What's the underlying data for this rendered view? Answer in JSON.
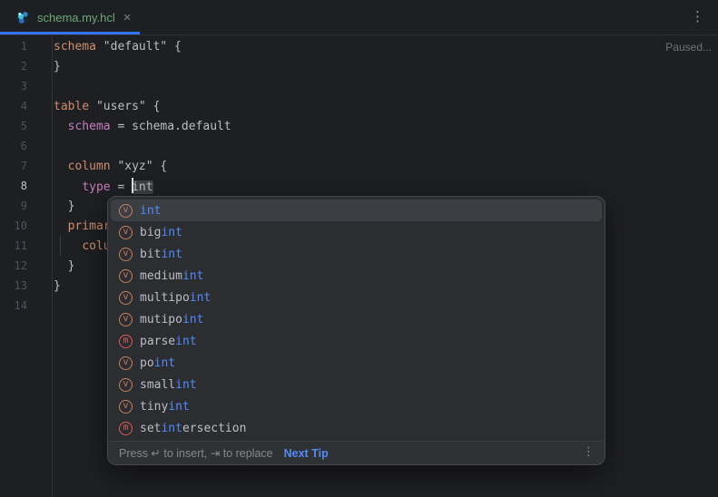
{
  "tab_bar": {
    "tab_title": "schema.my.hcl",
    "close_label": "×",
    "menu_icon": "⋮"
  },
  "editor": {
    "status": "Paused...",
    "lines": [
      {
        "num": "1",
        "segs": [
          [
            "kw",
            "schema"
          ],
          [
            "plain",
            " \"default\" {"
          ]
        ]
      },
      {
        "num": "2",
        "segs": [
          [
            "plain",
            "}"
          ]
        ]
      },
      {
        "num": "3",
        "segs": []
      },
      {
        "num": "4",
        "segs": [
          [
            "kw",
            "table"
          ],
          [
            "plain",
            " \"users\" {"
          ]
        ]
      },
      {
        "num": "5",
        "segs": [
          [
            "plain",
            "  "
          ],
          [
            "prop",
            "schema"
          ],
          [
            "plain",
            " = schema.default"
          ]
        ]
      },
      {
        "num": "6",
        "segs": []
      },
      {
        "num": "7",
        "segs": [
          [
            "plain",
            "  "
          ],
          [
            "kw",
            "column"
          ],
          [
            "plain",
            " \"xyz\" {"
          ]
        ]
      },
      {
        "num": "8",
        "current": true,
        "segs": [
          [
            "plain",
            "    "
          ],
          [
            "prop",
            "type"
          ],
          [
            "plain",
            " = "
          ],
          [
            "caret",
            ""
          ],
          [
            "boxed",
            "int"
          ]
        ]
      },
      {
        "num": "9",
        "segs": [
          [
            "plain",
            "  }"
          ]
        ]
      },
      {
        "num": "10",
        "segs": [
          [
            "plain",
            "  "
          ],
          [
            "kw",
            "primar"
          ]
        ]
      },
      {
        "num": "11",
        "segs": [
          [
            "plain",
            "    "
          ],
          [
            "kw",
            "colu"
          ]
        ]
      },
      {
        "num": "12",
        "segs": [
          [
            "plain",
            "  }"
          ]
        ]
      },
      {
        "num": "13",
        "segs": [
          [
            "plain",
            "}"
          ]
        ]
      },
      {
        "num": "14",
        "segs": []
      }
    ]
  },
  "completion": {
    "items": [
      {
        "icon": "v",
        "pre": "",
        "match": "int",
        "post": "",
        "selected": true
      },
      {
        "icon": "v",
        "pre": "big",
        "match": "int",
        "post": ""
      },
      {
        "icon": "v",
        "pre": "bit",
        "match": "int",
        "post": ""
      },
      {
        "icon": "v",
        "pre": "medium",
        "match": "int",
        "post": ""
      },
      {
        "icon": "v",
        "pre": "multipo",
        "match": "int",
        "post": ""
      },
      {
        "icon": "v",
        "pre": "mutipo",
        "match": "int",
        "post": ""
      },
      {
        "icon": "m",
        "pre": "parse",
        "match": "int",
        "post": ""
      },
      {
        "icon": "v",
        "pre": "po",
        "match": "int",
        "post": ""
      },
      {
        "icon": "v",
        "pre": "small",
        "match": "int",
        "post": ""
      },
      {
        "icon": "v",
        "pre": "tiny",
        "match": "int",
        "post": ""
      },
      {
        "icon": "m",
        "pre": "set",
        "match": "int",
        "post": "ersection"
      }
    ],
    "footer": {
      "hint": "Press ↵ to insert, ⇥ to replace",
      "link": "Next Tip",
      "menu_icon": "⋮"
    }
  },
  "colors": {
    "accent_blue": "#3574F0",
    "match_blue": "#548AF7",
    "keyword_orange": "#CF8E6D",
    "property_magenta": "#C77DBB",
    "tab_title_green": "#6AAB73",
    "variable_icon_orange": "#C97F63",
    "method_icon_red": "#DB5C5C",
    "editor_background": "#1E1F22",
    "popup_background": "#2B2D30"
  }
}
